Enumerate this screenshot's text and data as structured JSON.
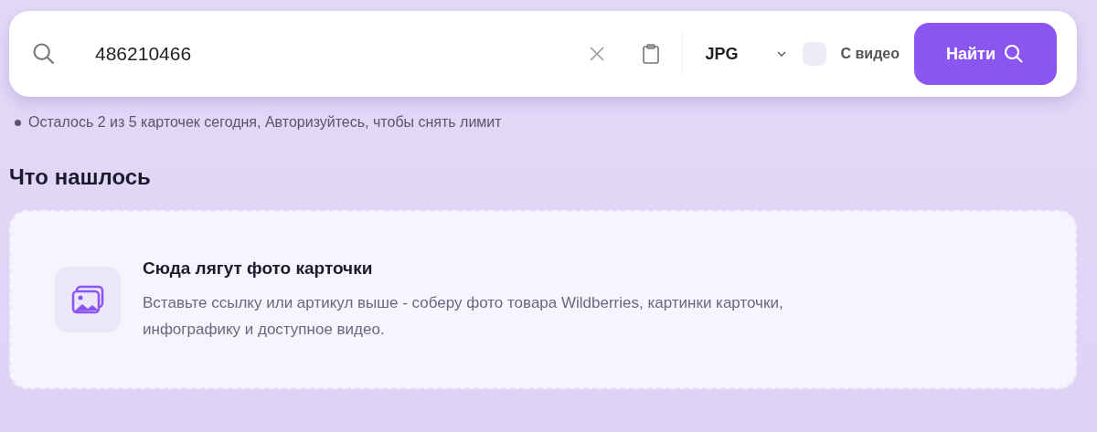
{
  "search": {
    "value": "486210466",
    "format": "JPG",
    "video_checkbox": {
      "label": "С видео",
      "checked": false
    },
    "submit": "Найти"
  },
  "limit_note": "Осталось 2 из 5 карточек сегодня, Авторизуйтесь, чтобы снять лимит",
  "section_title": "Что нашлось",
  "empty_state": {
    "title": "Сюда лягут фото карточки",
    "text": "Вставьте ссылку или артикул выше - соберу фото товара Wildberries, картинки карточки, инфографику и доступное видео."
  }
}
